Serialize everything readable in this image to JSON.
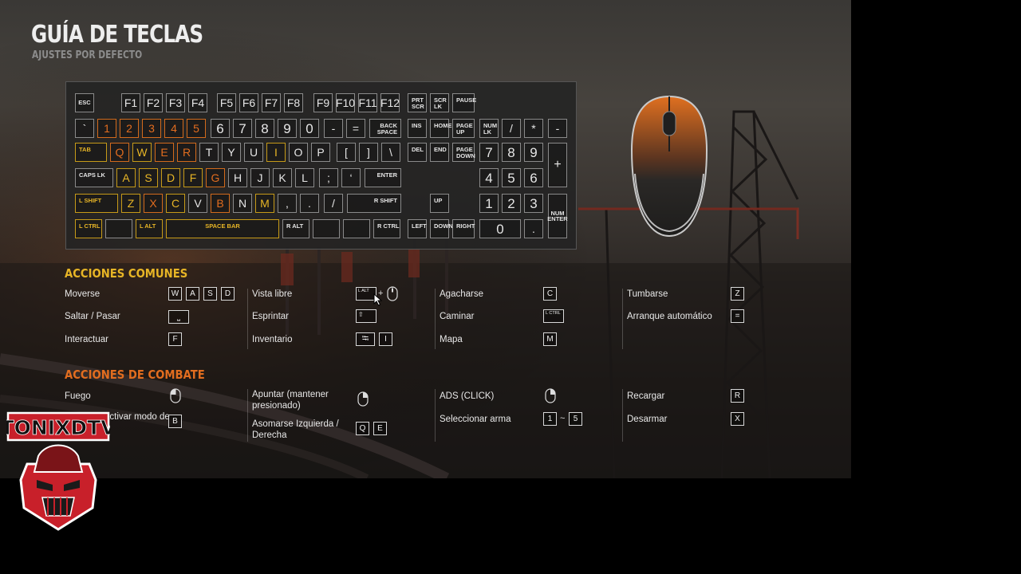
{
  "header": {
    "title": "GUÍA DE TECLAS",
    "subtitle": "AJUSTES POR DEFECTO"
  },
  "colors": {
    "movement_keys": "#e7b526",
    "combat_keys": "#e26d1f",
    "mouse_accent": "#e07020"
  },
  "keyboard": {
    "row_function": [
      "ESC",
      "F1",
      "F2",
      "F3",
      "F4",
      "F5",
      "F6",
      "F7",
      "F8",
      "F9",
      "F10",
      "F11",
      "F12",
      "PRT SCR",
      "SCR LK",
      "PAUSE"
    ],
    "row_number": [
      "`",
      "1",
      "2",
      "3",
      "4",
      "5",
      "6",
      "7",
      "8",
      "9",
      "0",
      "-",
      "=",
      "BACK SPACE",
      "INS",
      "HOME",
      "PAGE UP",
      "NUM LK",
      "/",
      "*",
      "-"
    ],
    "row_qwerty": [
      "TAB",
      "Q",
      "W",
      "E",
      "R",
      "T",
      "Y",
      "U",
      "I",
      "O",
      "P",
      "[",
      "]",
      "\\",
      "DEL",
      "END",
      "PAGE DOWN",
      "7",
      "8",
      "9",
      "+"
    ],
    "row_home": [
      "CAPS LK",
      "A",
      "S",
      "D",
      "F",
      "G",
      "H",
      "J",
      "K",
      "L",
      ";",
      "‘",
      "ENTER",
      "4",
      "5",
      "6"
    ],
    "row_shift": [
      "L SHIFT",
      "Z",
      "X",
      "C",
      "V",
      "B",
      "N",
      "M",
      ",",
      ".",
      "/",
      "R SHIFT",
      "UP",
      "1",
      "2",
      "3",
      "NUM ENTER"
    ],
    "row_bottom": [
      "L CTRL",
      "",
      "L ALT",
      "SPACE BAR",
      "R ALT",
      "",
      "",
      "R CTRL",
      "LEFT",
      "DOWN",
      "RIGHT",
      "0",
      "."
    ]
  },
  "sections": {
    "common": {
      "title": "ACCIONES COMUNES",
      "items": [
        {
          "label": "Moverse",
          "keys": [
            "W",
            "A",
            "S",
            "D"
          ]
        },
        {
          "label": "Saltar / Pasar",
          "keys": [
            "⎵"
          ]
        },
        {
          "label": "Interactuar",
          "keys": [
            "F"
          ]
        },
        {
          "label": "Vista libre",
          "keys": [
            "L ALT",
            "+"
          ],
          "icon": "mouse-icon"
        },
        {
          "label": "Esprintar",
          "keys": [
            "⇧"
          ]
        },
        {
          "label": "Inventario",
          "keys": [
            "⭾",
            "I"
          ]
        },
        {
          "label": "Agacharse",
          "keys": [
            "C"
          ]
        },
        {
          "label": "Caminar",
          "keys": [
            "L CTRL"
          ]
        },
        {
          "label": "Mapa",
          "keys": [
            "M"
          ]
        },
        {
          "label": "Tumbarse",
          "keys": [
            "Z"
          ]
        },
        {
          "label": "Arranque automático",
          "keys": [
            "="
          ]
        }
      ]
    },
    "combat": {
      "title": "ACCIONES DE COMBATE",
      "items": [
        {
          "label": "Fuego",
          "icon": "mouse-left-click-icon"
        },
        {
          "label": "activar modo de",
          "keys": [
            "B"
          ]
        },
        {
          "label": "Apuntar (mantener presionado)",
          "icon": "mouse-right-click-icon"
        },
        {
          "label": "Asomarse Izquierda / Derecha",
          "keys": [
            "Q",
            "E"
          ]
        },
        {
          "label": "ADS (CLICK)",
          "icon": "mouse-right-click-icon"
        },
        {
          "label": "Seleccionar arma",
          "keys": [
            "1",
            "~",
            "5"
          ]
        },
        {
          "label": "Recargar",
          "keys": [
            "R"
          ]
        },
        {
          "label": "Desarmar",
          "keys": [
            "X"
          ]
        }
      ]
    }
  },
  "logo": {
    "text": "TONIXDTV",
    "icon": "samurai-mask-icon"
  }
}
